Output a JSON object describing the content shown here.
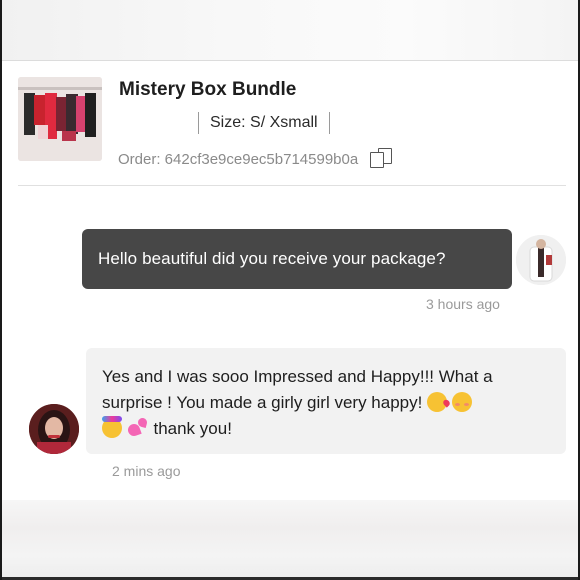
{
  "order": {
    "title": "Mistery Box Bundle",
    "size": "Size: S/ Xsmall",
    "order_number": "Order: 642cf3e9ce9ec5b714599b0a"
  },
  "messages": {
    "sent": {
      "text": "Hello beautiful did you receive your package?",
      "time": "3 hours ago"
    },
    "received": {
      "line1": "Yes and I was sooo Impressed and Happy!!! What a",
      "line2": "surprise ! You made a girly girl very happy!",
      "line3": "thank you!",
      "time": "2 mins ago"
    }
  },
  "colors": {
    "sent_bubble": "#474747",
    "received_bubble": "#f2f2f2",
    "muted_text": "#9a9a9a"
  },
  "icons": [
    "copy-icon",
    "face-blowing-kiss-emoji",
    "smiling-blush-emoji",
    "party-face-emoji",
    "two-hearts-emoji"
  ]
}
